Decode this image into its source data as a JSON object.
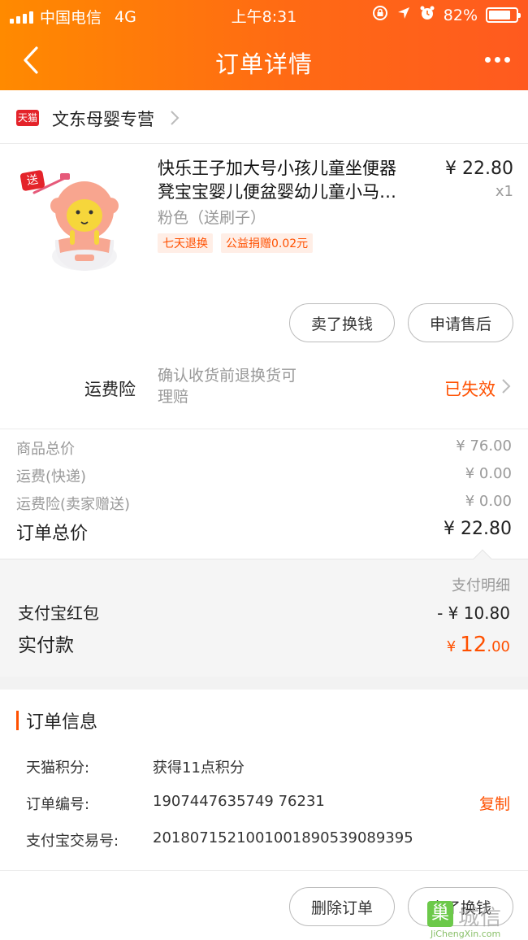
{
  "status_bar": {
    "carrier": "中国电信",
    "network": "4G",
    "time": "上午8:31",
    "battery": "82%",
    "battery_level": 0.82
  },
  "nav": {
    "title": "订单详情"
  },
  "shop": {
    "badge": "天猫",
    "name": "文东母婴专营"
  },
  "product": {
    "title_line1": "快乐王子加大号小孩儿童坐便器",
    "title_line2": "凳宝宝婴儿便盆婴幼儿童小马…",
    "variant": "粉色（送刷子）",
    "tags": [
      "七天退换",
      "公益捐赠0.02元"
    ],
    "price": "¥ 22.80",
    "quantity": "x1",
    "gift_badge": "送",
    "buttons": {
      "sell": "卖了换钱",
      "after_sale": "申请售后"
    }
  },
  "insurance": {
    "label": "运费险",
    "description_line1": "确认收货前退换货可",
    "description_line2": "理赔",
    "status": "已失效"
  },
  "summary": {
    "goods_total_label": "商品总价",
    "goods_total": "¥ 76.00",
    "shipping_label": "运费(快递)",
    "shipping": "¥ 0.00",
    "insurance_label": "运费险(卖家赠送)",
    "insurance": "¥ 0.00",
    "order_total_label": "订单总价",
    "order_total": "¥ 22.80"
  },
  "payment": {
    "detail_link": "支付明细",
    "redpacket_label": "支付宝红包",
    "redpacket": "- ¥ 10.80",
    "paid_label": "实付款",
    "paid_currency": "¥",
    "paid_integer": "12",
    "paid_decimal": ".00"
  },
  "order_info": {
    "title": "订单信息",
    "points_label": "天猫积分:",
    "points": "获得11点积分",
    "order_no_label": "订单编号:",
    "order_no": "1907447635749 76231",
    "copy_label": "复制",
    "trade_no_label": "支付宝交易号:",
    "trade_no": "2018071521001001890539089395"
  },
  "bottom_bar": {
    "delete_label": "删除订单",
    "sell_label": "卖了换钱"
  },
  "watermark": {
    "glyph": "巢",
    "text": "城信",
    "url": "JiChengXin.com"
  },
  "colors": {
    "brand_orange": "#ff5000",
    "header_gradient_start": "#ff8a00",
    "header_gradient_end": "#ff5a1f",
    "tmall_red": "#e4232a"
  }
}
